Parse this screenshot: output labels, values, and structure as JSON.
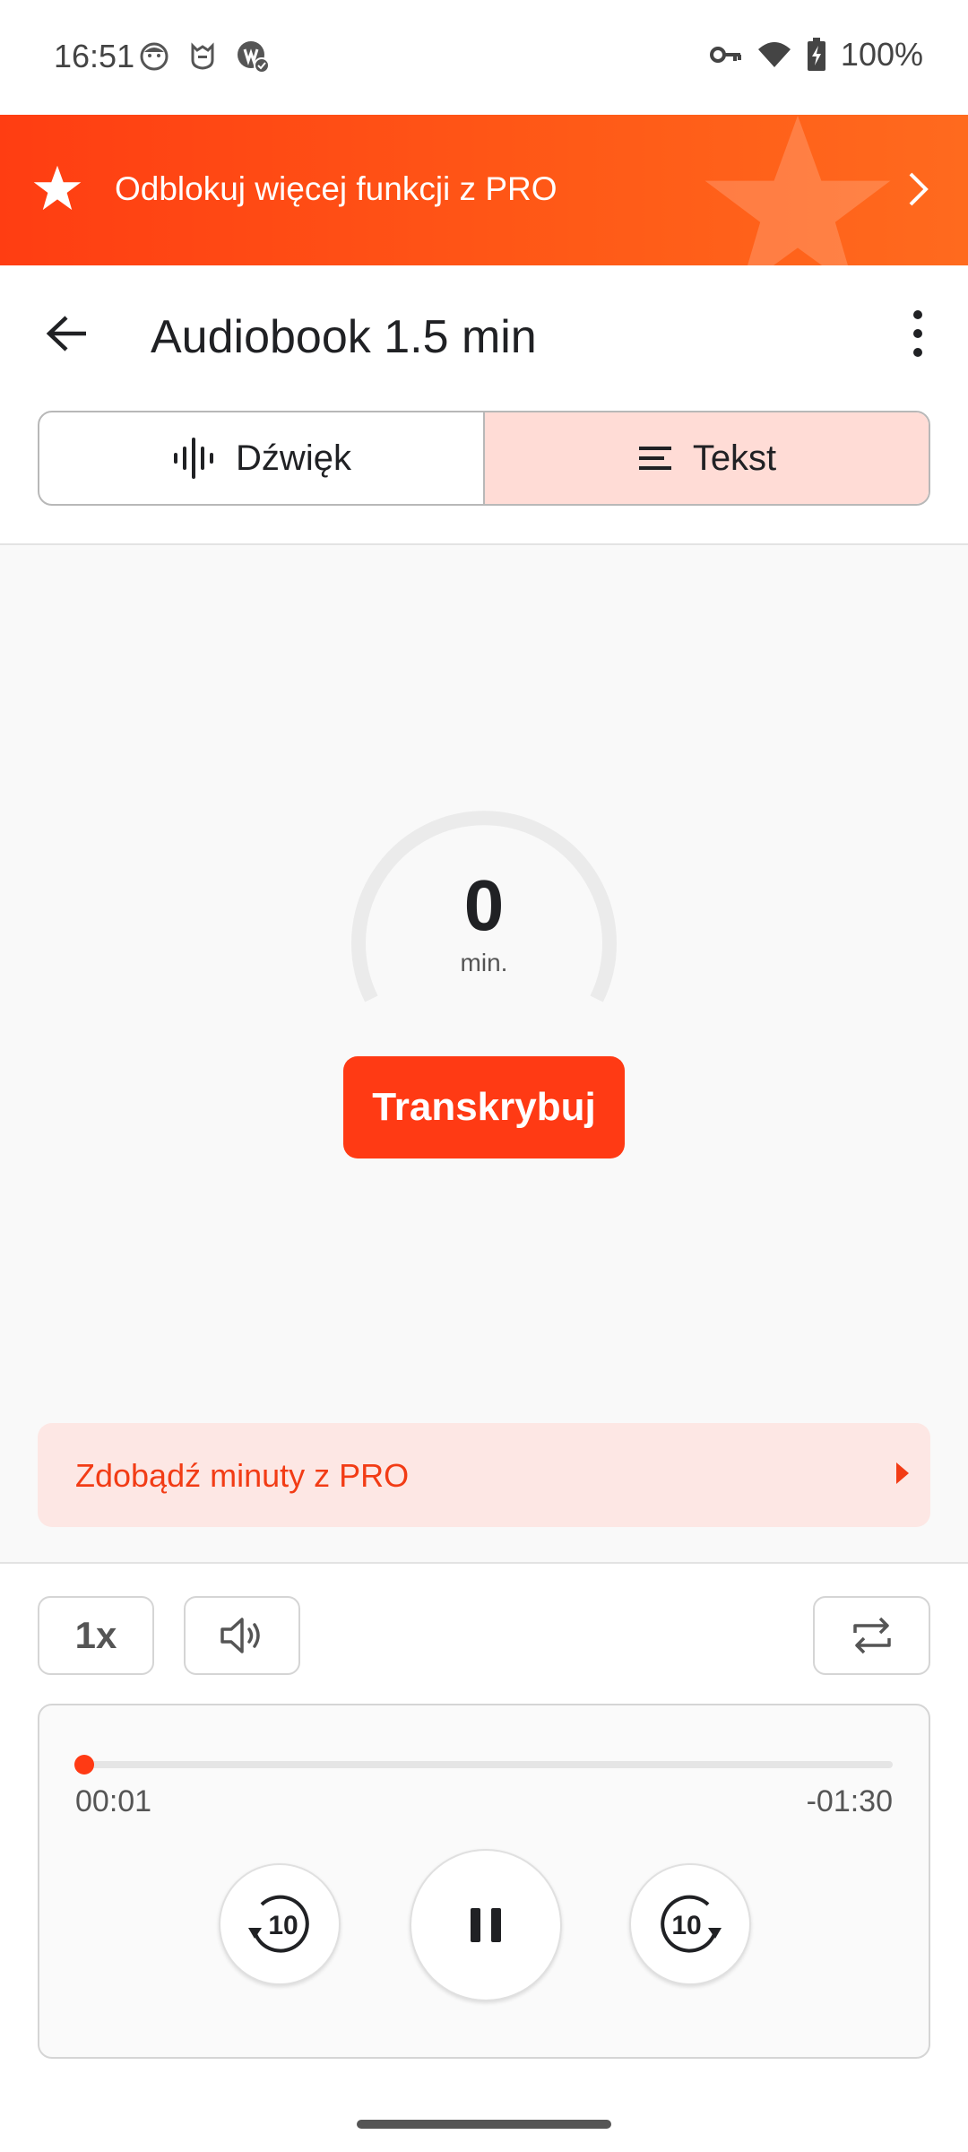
{
  "status_bar": {
    "time": "16:51",
    "battery": "100%",
    "left_icons": [
      "face-icon",
      "mi-icon",
      "notification-app-icon"
    ],
    "right_icons": [
      "vpn-key-icon",
      "wifi-icon",
      "battery-charging-icon"
    ]
  },
  "promo": {
    "text": "Odblokuj więcej funkcji z PRO",
    "icon": "star-icon"
  },
  "header": {
    "title": "Audiobook 1.5 min"
  },
  "tabs": [
    {
      "label": "Dźwięk",
      "icon": "waveform-icon",
      "active": false
    },
    {
      "label": "Tekst",
      "icon": "text-lines-icon",
      "active": true
    }
  ],
  "gauge": {
    "value": "0",
    "unit": "min.",
    "fill_fraction": 0
  },
  "transcribe_button": "Transkrybuj",
  "get_minutes": {
    "label": "Zdobądź minuty z PRO"
  },
  "controls": {
    "speed": "1x"
  },
  "player": {
    "elapsed": "00:01",
    "remaining": "-01:30",
    "progress_fraction": 0.011,
    "rewind_seconds": "10",
    "forward_seconds": "10"
  },
  "colors": {
    "accent": "#ff3a14",
    "tab_active_bg": "#ffdcd6",
    "get_minutes_bg": "#fde7e4"
  }
}
